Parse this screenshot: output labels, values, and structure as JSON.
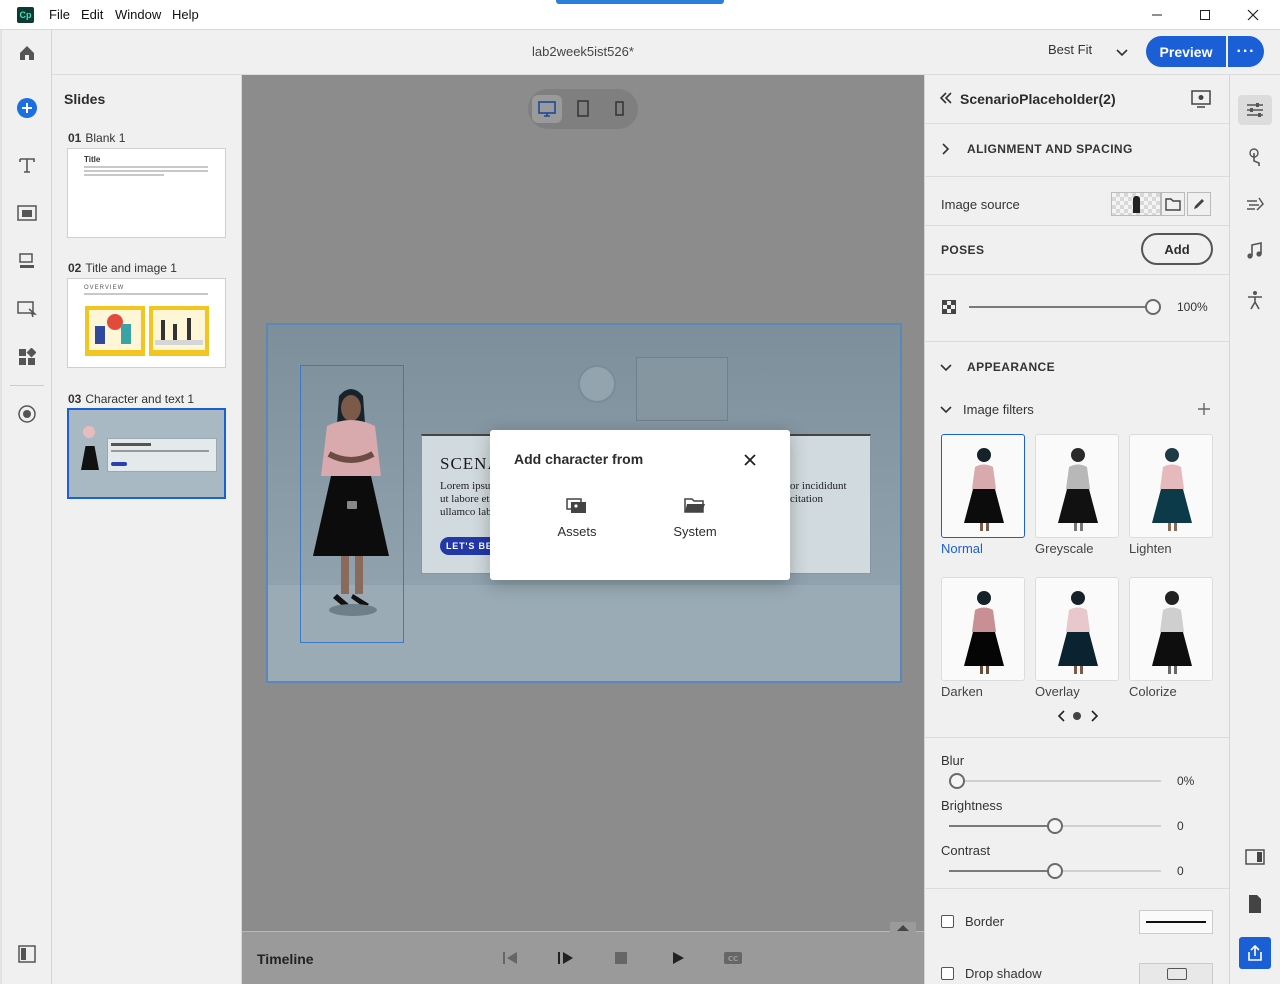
{
  "menu": {
    "app_logo": "Cp",
    "file": "File",
    "edit": "Edit",
    "window": "Window",
    "help": "Help"
  },
  "header": {
    "doc_title": "lab2week5ist526*",
    "zoom": "Best Fit",
    "preview": "Preview",
    "more": "···"
  },
  "slides": {
    "title": "Slides",
    "items": [
      {
        "num": "01",
        "name": "Blank 1",
        "thumb_title": "Title"
      },
      {
        "num": "02",
        "name": "Title and image 1",
        "thumb_title": "OVERVIEW"
      },
      {
        "num": "03",
        "name": "Character and text 1"
      }
    ]
  },
  "stage": {
    "card_title": "SCENA",
    "body_left": [
      "Lorem ipsu",
      "ut labore et",
      "ullamco lab"
    ],
    "body_right": [
      "or incididunt",
      "citation"
    ],
    "button": "LET'S BEGI"
  },
  "timeline": {
    "label": "Timeline"
  },
  "modal": {
    "title": "Add character from",
    "options": [
      "Assets",
      "System"
    ]
  },
  "props": {
    "title": "ScenarioPlaceholder(2)",
    "alignment": "ALIGNMENT AND SPACING",
    "image_source": "Image source",
    "poses": "POSES",
    "add": "Add",
    "opacity": "100%",
    "appearance": "APPEARANCE",
    "image_filters": "Image filters",
    "filters": [
      "Normal",
      "Greyscale",
      "Lighten",
      "Darken",
      "Overlay",
      "Colorize"
    ],
    "blur": {
      "label": "Blur",
      "value": "0%"
    },
    "brightness": {
      "label": "Brightness",
      "value": "0"
    },
    "contrast": {
      "label": "Contrast",
      "value": "0"
    },
    "border": "Border",
    "drop_shadow": "Drop shadow"
  },
  "colors": {
    "accent": "#1b5fd6",
    "stage_border": "#5a88bb"
  }
}
